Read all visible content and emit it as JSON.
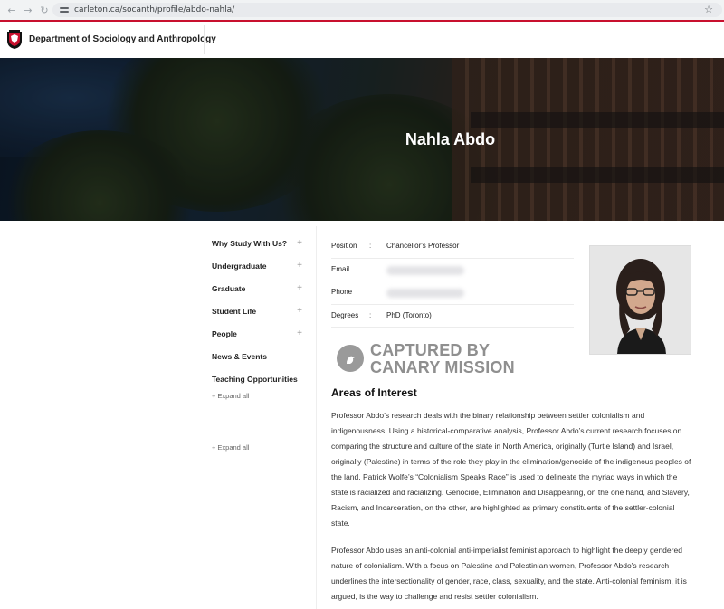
{
  "browser": {
    "url": "carleton.ca/socanth/profile/abdo-nahla/",
    "back_glyph": "←",
    "forward_glyph": "→",
    "reload_glyph": "↻",
    "star_glyph": "☆"
  },
  "header": {
    "department": "Department of Sociology and Anthropology",
    "accent_color": "#c8102e"
  },
  "hero": {
    "name": "Nahla Abdo"
  },
  "sidebar": {
    "items": [
      {
        "label": "Why Study With Us?",
        "plus": "+"
      },
      {
        "label": "Undergraduate",
        "plus": "+"
      },
      {
        "label": "Graduate",
        "plus": "+"
      },
      {
        "label": "Student Life",
        "plus": "+"
      },
      {
        "label": "People",
        "plus": "+"
      },
      {
        "label": "News & Events",
        "plus": ""
      },
      {
        "label": "Teaching Opportunities",
        "plus": ""
      }
    ],
    "expand_plus": "+",
    "expand_label": "Expand all"
  },
  "profile": {
    "colon": ":",
    "position_label": "Position",
    "position_value": "Chancellor's Professor",
    "email_label": "Email",
    "phone_label": "Phone",
    "degrees_label": "Degrees",
    "degrees_value": "PhD (Toronto)"
  },
  "watermark": {
    "line1": "CAPTURED BY",
    "line2": "CANARY MISSION"
  },
  "content": {
    "areas_title": "Areas of Interest",
    "paragraph1": "Professor Abdo’s research deals with the binary relationship between settler colonialism and indigenousness. Using a historical-comparative analysis, Professor Abdo’s current research focuses on comparing the structure and culture of the state in North America, originally (Turtle Island) and Israel, originally (Palestine) in terms of the role they play in the elimination/genocide of the indigenous peoples of the land. Patrick Wolfe’s “Colonialism Speaks Race” is used to delineate the myriad ways in which the state is racialized and racializing. Genocide, Elimination and Disappearing, on the one hand, and Slavery, Racism, and Incarceration, on the other, are highlighted as primary constituents of the settler-colonial state.",
    "paragraph2": "Professor Abdo uses an anti-colonial anti-imperialist feminist approach to highlight the deeply gendered nature of colonialism. With a focus on Palestine and Palestinian women, Professor Abdo’s research underlines the intersectionality of gender, race, class, sexuality, and the state. Anti-colonial feminism, it is argued, is the way to challenge and resist settler colonialism."
  }
}
